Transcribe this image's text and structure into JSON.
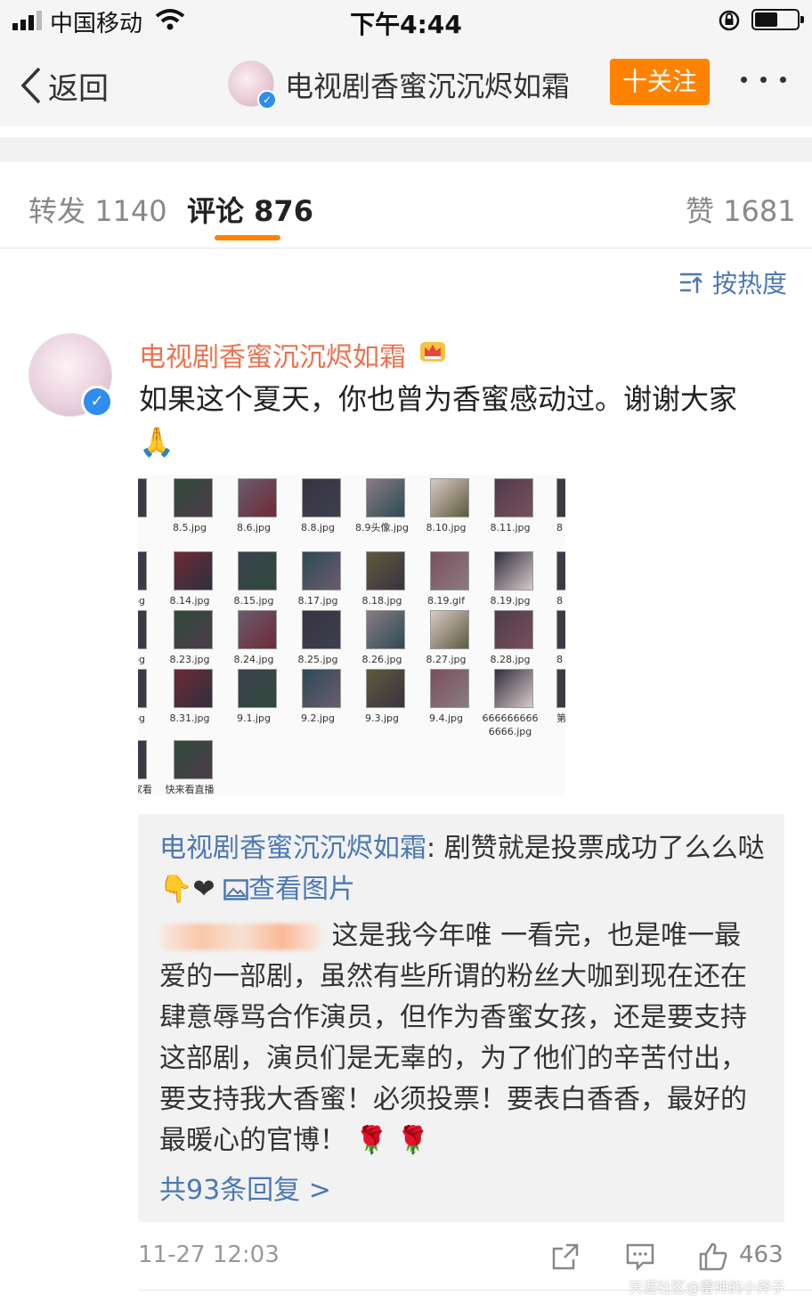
{
  "status_bar": {
    "carrier": "中国移动",
    "time": "下午4:44",
    "battery_level": 0.55
  },
  "nav": {
    "back_label": "返回",
    "title": "电视剧香蜜沉沉烬如霜",
    "follow_label": "十关注"
  },
  "tabs": [
    {
      "label": "转发",
      "count": "1140"
    },
    {
      "label": "评论",
      "count": "876"
    },
    {
      "label": "赞",
      "count": "1681"
    }
  ],
  "sort": {
    "label": "按热度"
  },
  "comment": {
    "username": "电视剧香蜜沉沉烬如霜",
    "text": "如果这个夏天，你也曾为香蜜感动过。谢谢大家",
    "emoji": "🙏",
    "image": {
      "rows": [
        [
          "8.5.jpg",
          "8.6.jpg",
          "8.8.jpg",
          "8.9头像.jpg",
          "8.10.jpg",
          "8.11.jpg"
        ],
        [
          "8.14.jpg",
          "8.15.jpg",
          "8.17.jpg",
          "8.18.jpg",
          "8.19.gif",
          "8.19.jpg"
        ],
        [
          "8.23.jpg",
          "8.24.jpg",
          "8.25.jpg",
          "8.26.jpg",
          "8.27.jpg",
          "8.28.jpg"
        ],
        [
          "8.31.jpg",
          "9.1.jpg",
          "9.2.jpg",
          "9.3.jpg",
          "9.4.jpg",
          "6666666666666.jpg"
        ],
        [
          "快来看直播吧.gif"
        ]
      ],
      "left_edge_labels": [
        "f",
        "pg",
        "pg",
        "pg",
        "家看 gif"
      ],
      "right_edge_labels": [
        "8",
        "8",
        "8",
        "第"
      ]
    },
    "reply1": {
      "user": "电视剧香蜜沉沉烬如霜",
      "text": "剧赞就是投票成功了么么哒",
      "emoji": "👇❤",
      "view_image_label": "查看图片"
    },
    "reply2": {
      "lines": [
        "这是我今年唯 一看完，也是唯一最",
        "爱的一部剧，虽然有些所谓的粉丝大咖到现在还在",
        "肆意辱骂合作演员，但作为香蜜女孩，还是要支持",
        "这部剧，演员们是无辜的，为了他们的辛苦付出，",
        "要支持我大香蜜！必须投票！要表白香香，最好的",
        "最暖心的官博！"
      ],
      "roses": "🌹 🌹"
    },
    "replies_link": "共93条回复 >",
    "timestamp": "11-27 12:03",
    "likes": "463"
  },
  "watermark": "天涯社区@雷神的小斧子"
}
